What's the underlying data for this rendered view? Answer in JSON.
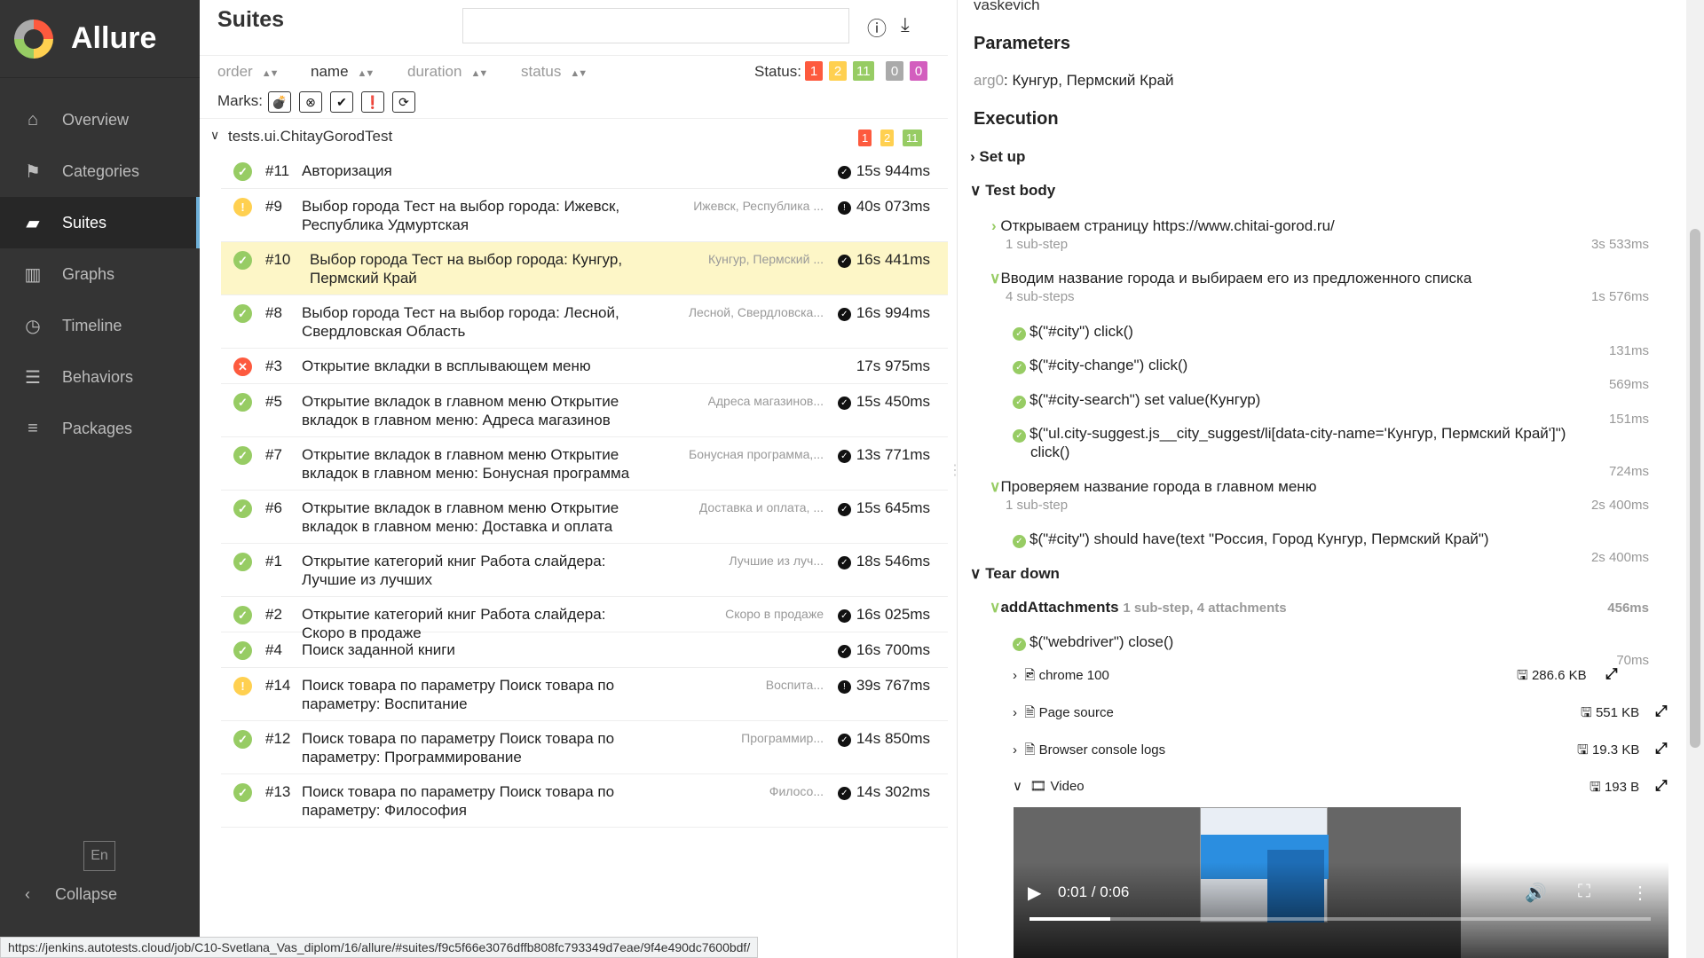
{
  "sidebar": {
    "brand": "Allure",
    "items": [
      {
        "label": "Overview",
        "icon": "home-icon"
      },
      {
        "label": "Categories",
        "icon": "flag-icon"
      },
      {
        "label": "Suites",
        "icon": "briefcase-icon"
      },
      {
        "label": "Graphs",
        "icon": "bar-chart-icon"
      },
      {
        "label": "Timeline",
        "icon": "clock-icon"
      },
      {
        "label": "Behaviors",
        "icon": "list-icon"
      },
      {
        "label": "Packages",
        "icon": "align-left-icon"
      }
    ],
    "active": "Suites",
    "lang": "En",
    "collapse": "Collapse"
  },
  "status_url": "https://jenkins.autotests.cloud/job/C10-Svetlana_Vas_diplom/16/allure/#suites/f9c5f66e3076dffb808fc793349d7eae/9f4e490dc7600bdf/",
  "suites": {
    "title": "Suites",
    "sort": [
      "order",
      "name",
      "duration",
      "status"
    ],
    "status_label": "Status:",
    "status_counts": [
      {
        "value": "1",
        "color": "#fd5a3e"
      },
      {
        "value": "2",
        "color": "#ffd050"
      },
      {
        "value": "11",
        "color": "#97cc64"
      },
      {
        "value": "0",
        "color": "#aaaaaa"
      },
      {
        "value": "0",
        "color": "#d35ebe"
      }
    ],
    "marks_label": "Marks:",
    "group": {
      "name": "tests.ui.ChitayGorodTest",
      "counts": [
        {
          "value": "1",
          "color": "#fd5a3e"
        },
        {
          "value": "2",
          "color": "#ffd050"
        },
        {
          "value": "11",
          "color": "#97cc64"
        }
      ]
    },
    "tests": [
      {
        "status": "passed",
        "num": "#11",
        "name": "Авторизация",
        "param": "",
        "duration": "15s 944ms"
      },
      {
        "status": "broken",
        "num": "#9",
        "name": "Выбор города Тест на выбор города: Ижевск, Республика Удмуртская",
        "param": "Ижевск, Республика ...",
        "duration": "40s 073ms"
      },
      {
        "status": "passed",
        "num": "#10",
        "name": "Выбор города Тест на выбор города: Кунгур, Пермский Край",
        "param": "Кунгур, Пермский ...",
        "duration": "16s 441ms",
        "selected": true
      },
      {
        "status": "passed",
        "num": "#8",
        "name": "Выбор города Тест на выбор города: Лесной, Свердловская Область",
        "param": "Лесной, Свердловска...",
        "duration": "16s 994ms"
      },
      {
        "status": "failed",
        "num": "#3",
        "name": "Открытие вкладки в всплывающем меню",
        "param": "",
        "duration": "17s 975ms"
      },
      {
        "status": "passed",
        "num": "#5",
        "name": "Открытие вкладок в главном меню Открытие вкладок в главном меню: Адреса магазинов",
        "param": "Адреса магазинов...",
        "duration": "15s 450ms"
      },
      {
        "status": "passed",
        "num": "#7",
        "name": "Открытие вкладок в главном меню Открытие вкладок в главном меню: Бонусная программа",
        "param": "Бонусная программа,...",
        "duration": "13s 771ms"
      },
      {
        "status": "passed",
        "num": "#6",
        "name": "Открытие вкладок в главном меню Открытие вкладок в главном меню: Доставка и оплата",
        "param": "Доставка и оплата, ...",
        "duration": "15s 645ms"
      },
      {
        "status": "passed",
        "num": "#1",
        "name": "Открытие категорий книг Работа слайдера: Лучшие из лучших",
        "param": "Лучшие из луч...",
        "duration": "18s 546ms"
      },
      {
        "status": "passed",
        "num": "#2",
        "name": "Открытие категорий книг Работа слайдера: Скоро в продаже",
        "param": "Скоро в продаже",
        "duration": "16s 025ms"
      },
      {
        "status": "passed",
        "num": "#4",
        "name": "Поиск заданной книги",
        "param": "",
        "duration": "16s 700ms"
      },
      {
        "status": "broken",
        "num": "#14",
        "name": "Поиск товара по параметру Поиск товара по параметру: Воспитание",
        "param": "Воспита...",
        "duration": "39s 767ms"
      },
      {
        "status": "passed",
        "num": "#12",
        "name": "Поиск товара по параметру Поиск товара по параметру: Программирование",
        "param": "Программир...",
        "duration": "14s 850ms"
      },
      {
        "status": "passed",
        "num": "#13",
        "name": "Поиск товара по параметру Поиск товара по параметру: Философия",
        "param": "Филосо...",
        "duration": "14s 302ms"
      }
    ]
  },
  "detail": {
    "owner": "vaskevich",
    "parameters_title": "Parameters",
    "param_name": "arg0",
    "param_value": "Кунгур, Пермский Край",
    "execution_title": "Execution",
    "setup": "Set up",
    "body": "Test body",
    "teardown": "Tear down",
    "steps": [
      {
        "name": "Открываем страницу https://www.chitai-gorod.ru/",
        "sub": "1 sub-step",
        "duration": "3s 533ms"
      },
      {
        "name": "Вводим название города и выбираем его из предложенного списка",
        "sub": "4 sub-steps",
        "duration": "1s 576ms"
      },
      {
        "name": "$(\"#city\") click()",
        "duration": "131ms"
      },
      {
        "name": "$(\"#city-change\") click()",
        "duration": "569ms"
      },
      {
        "name": "$(\"#city-search\") set value(Кунгур)",
        "duration": "151ms"
      },
      {
        "name": "$(\"ul.city-suggest.js__city_suggest/li[data-city-name='Кунгур, Пермский Край']\")",
        "name2": "click()",
        "duration": "724ms"
      },
      {
        "name": "Проверяем название города в главном меню",
        "sub": "1 sub-step",
        "duration": "2s 400ms"
      },
      {
        "name": "$(\"#city\") should have(text \"Россия, Город Кунгур, Пермский Край\")",
        "duration": "2s 400ms"
      }
    ],
    "teardown_step": {
      "name": "addAttachments",
      "sub": "1 sub-step, 4 attachments",
      "duration": "456ms"
    },
    "close_step": {
      "name": "$(\"webdriver\") close()",
      "duration": "70ms"
    },
    "attachments": [
      {
        "name": "chrome 100",
        "size": "286.6 KB",
        "icon": "image-file-icon"
      },
      {
        "name": "Page source",
        "size": "551 KB",
        "icon": "text-file-icon"
      },
      {
        "name": "Browser console logs",
        "size": "19.3 KB",
        "icon": "text-file-icon"
      },
      {
        "name": "Video",
        "size": "193 B",
        "icon": "video-file-icon"
      }
    ],
    "video": {
      "time": "0:01 / 0:06",
      "progress": 0.13
    }
  }
}
